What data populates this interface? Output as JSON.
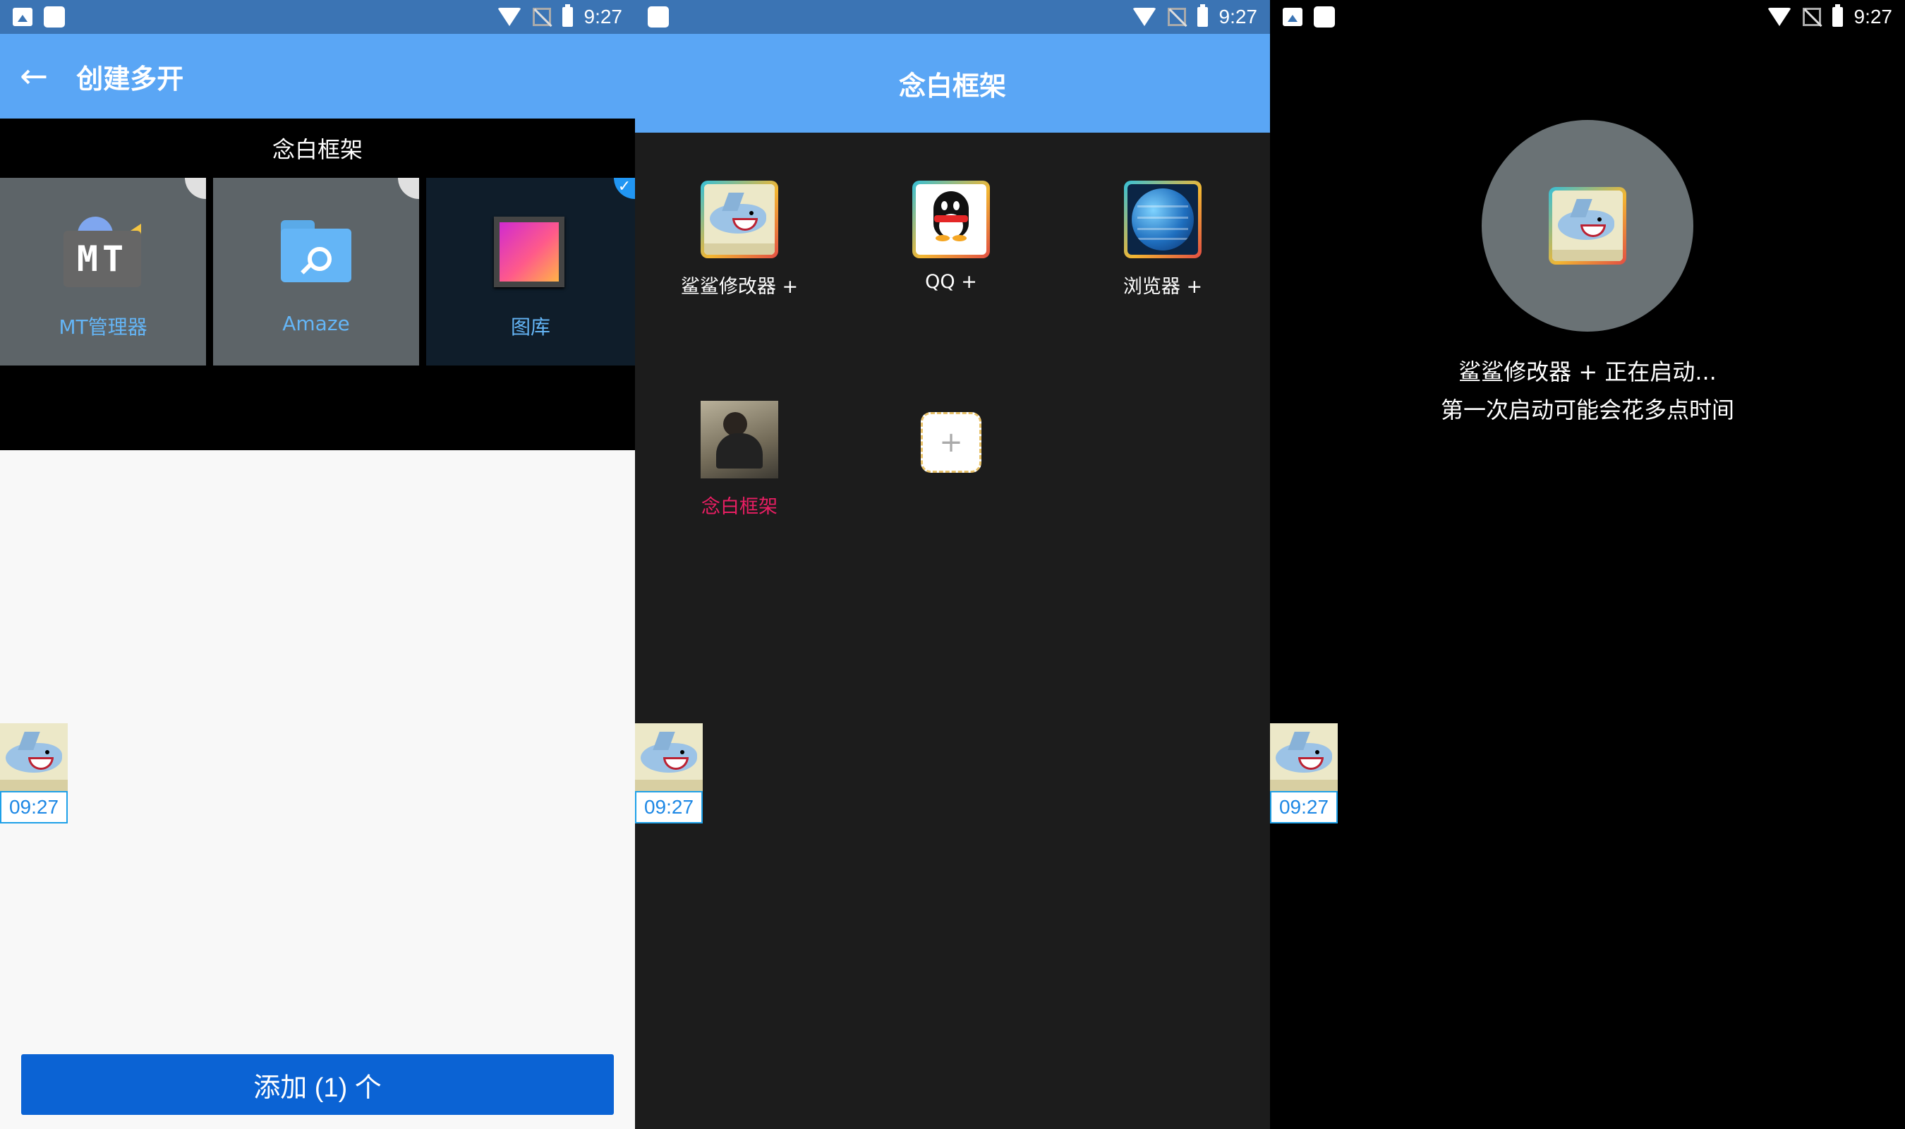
{
  "status_bar": {
    "time": "9:27"
  },
  "screen1": {
    "title": "创建多开",
    "framework_label": "念白框架",
    "apps": [
      {
        "label": "MT管理器",
        "selected": false
      },
      {
        "label": "Amaze",
        "selected": false
      },
      {
        "label": "图库",
        "selected": true
      }
    ],
    "add_button": "添加 (1) 个",
    "float_time": "09:27"
  },
  "screen2": {
    "title": "念白框架",
    "items": [
      {
        "label": "鲨鲨修改器 +",
        "icon": "shark-icon"
      },
      {
        "label": "QQ +",
        "icon": "qq-penguin-icon"
      },
      {
        "label": "浏览器 +",
        "icon": "globe-icon"
      },
      {
        "label": "念白框架",
        "icon": "photo-avatar",
        "color": "#e91e63"
      }
    ],
    "add_icon": "+",
    "float_time": "09:27"
  },
  "screen3": {
    "line1": "鲨鲨修改器 + 正在启动...",
    "line2": "第一次启动可能会花多点时间",
    "float_time": "09:27"
  },
  "colors": {
    "status_bar": "#3b74b4",
    "app_bar": "#5aa6f5",
    "button": "#0b63d4",
    "accent_label": "#64b5f6",
    "highlight": "#e91e63"
  }
}
